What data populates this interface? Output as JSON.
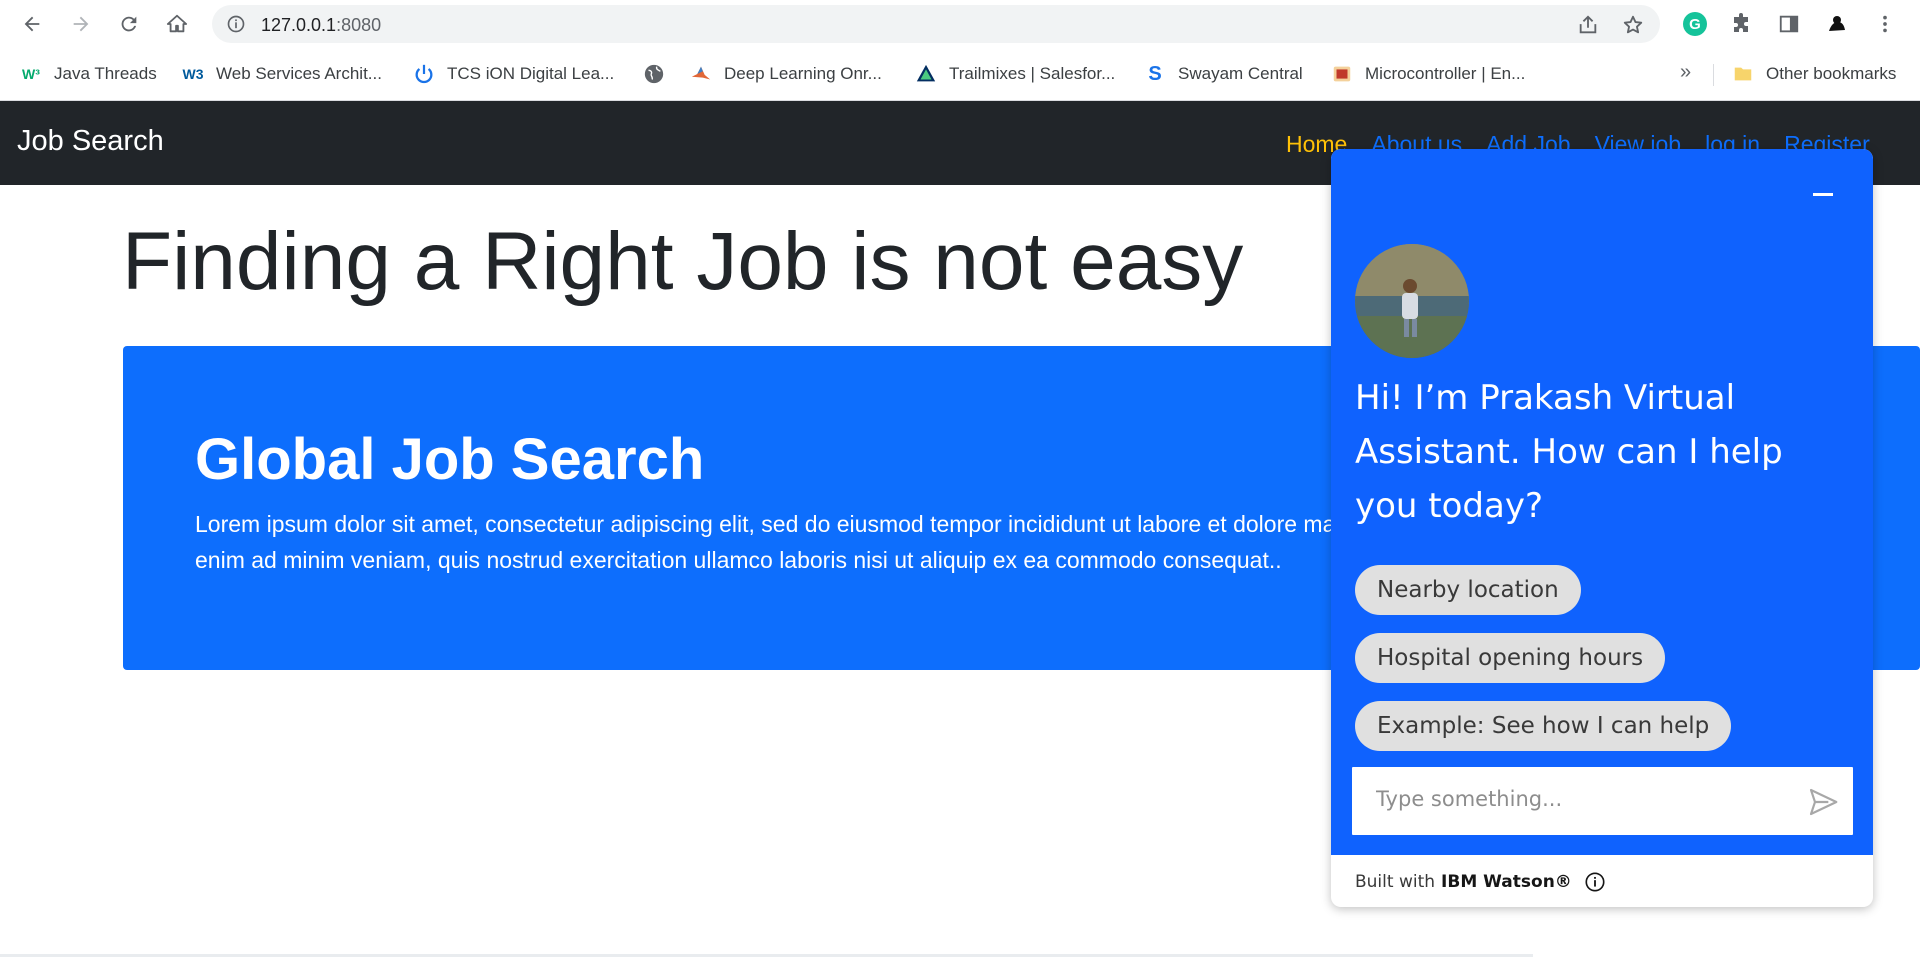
{
  "browser": {
    "url_host": "127.0.0.1",
    "url_port": ":8080",
    "bookmarks": [
      {
        "label": "Java Threads",
        "icon": "w3-icon",
        "color": "#04aa6d"
      },
      {
        "label": "Web Services Archit...",
        "icon": "w3c-icon",
        "color": "#005a9c"
      },
      {
        "label": "TCS iON Digital Lea...",
        "icon": "power-icon",
        "color": "#1a73e8"
      },
      {
        "label": "",
        "icon": "globe-icon",
        "color": "#5f6368"
      },
      {
        "label": "Deep Learning Onr...",
        "icon": "matlab-icon",
        "color": "#e16737"
      },
      {
        "label": "Trailmixes | Salesfor...",
        "icon": "trailhead-icon",
        "color": "#032e61"
      },
      {
        "label": "Swayam Central",
        "icon": "swayam-icon",
        "color": "#1a73e8"
      },
      {
        "label": "Microcontroller | En...",
        "icon": "book-icon",
        "color": "#c0392b"
      }
    ],
    "more_label": "»",
    "other_bookmarks": "Other bookmarks"
  },
  "site": {
    "brand": "Job Search",
    "nav": [
      "Home",
      "About us",
      "Add Job",
      "View job",
      "log in",
      "Register"
    ],
    "headline": "Finding a Right Job is not easy",
    "hero_title": "Global Job Search",
    "hero_text": "Lorem ipsum dolor sit amet, consectetur adipiscing elit, sed do eiusmod tempor incididunt ut labore et dolore magna aliqua. Ut enim ad minim veniam, quis nostrud exercitation ullamco laboris nisi ut aliquip ex ea commodo consequat.."
  },
  "chat": {
    "greeting": "Hi! I’m Prakash Virtual Assistant. How can I help you today?",
    "chips": [
      "Nearby location",
      "Hospital opening hours",
      "Example: See how I can help"
    ],
    "input_placeholder": "Type something...",
    "footer_prefix": "Built with",
    "footer_brand": "IBM Watson®",
    "accent": "#0f62fe"
  },
  "colors": {
    "navbar_bg": "#212529",
    "link": "#0d6efd",
    "active_link": "#ffc107",
    "hero_bg": "#0d6efd"
  }
}
